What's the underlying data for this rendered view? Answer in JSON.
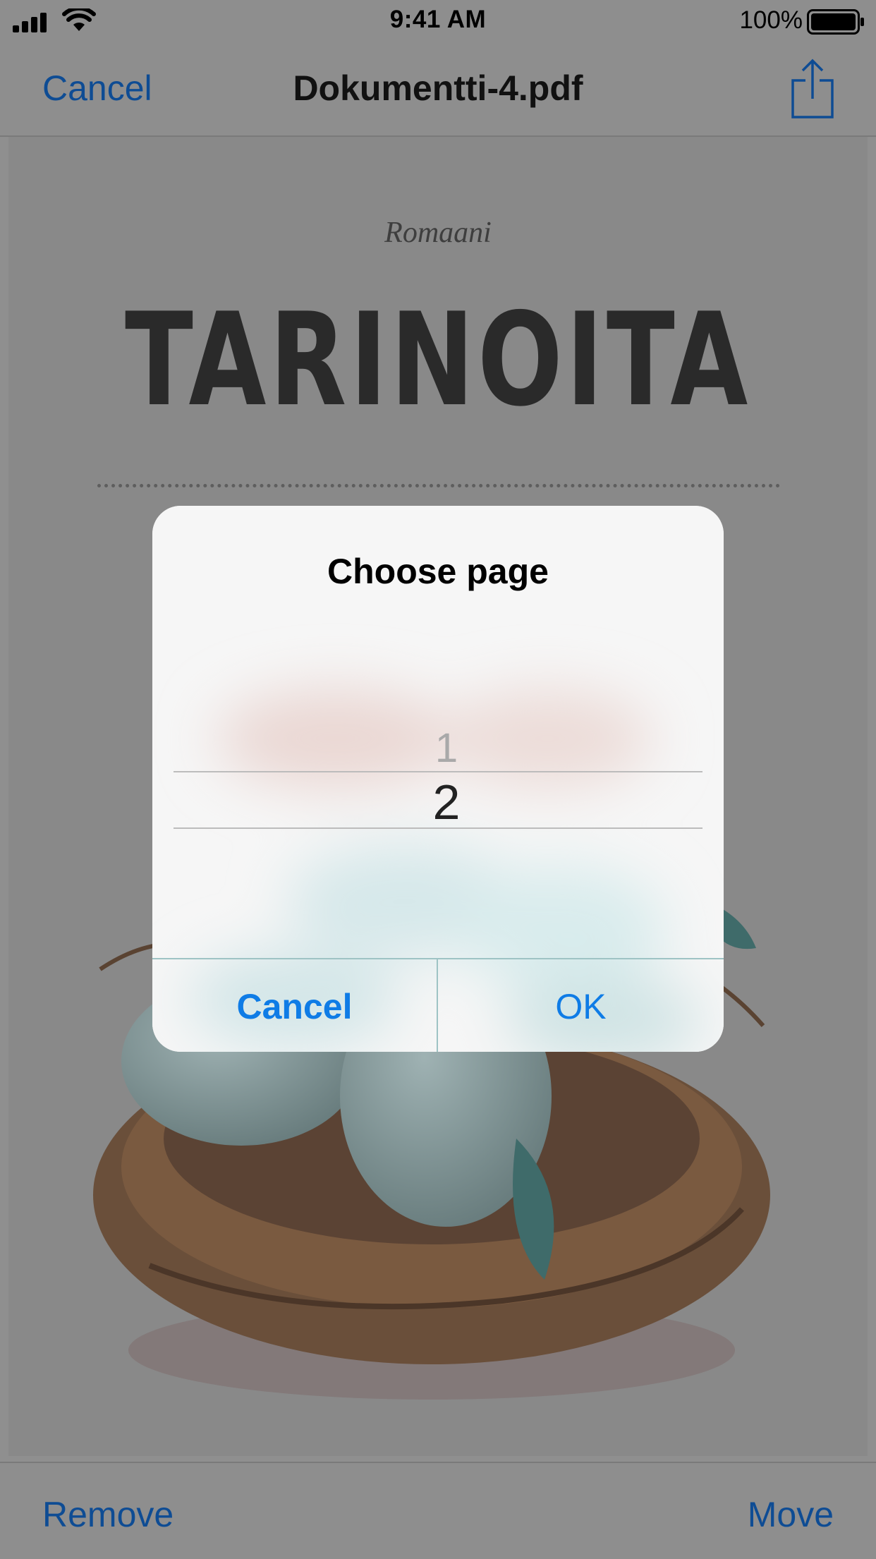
{
  "status_bar": {
    "time": "9:41 AM",
    "battery_percent": "100%",
    "battery_level": 1.0
  },
  "nav": {
    "cancel_label": "Cancel",
    "title": "Dokumentti-4.pdf",
    "share_icon": "share-icon"
  },
  "document": {
    "subtitle": "Romaani",
    "title": "TARINOITA"
  },
  "alert": {
    "title": "Choose page",
    "picker": {
      "previous_value": "1",
      "selected_value": "2"
    },
    "cancel_label": "Cancel",
    "ok_label": "OK",
    "accent_color": "#0f7ce6"
  },
  "bottom_bar": {
    "remove_label": "Remove",
    "move_label": "Move"
  },
  "colors": {
    "link": "#0e4c94",
    "dim_overlay": "#8e8e8e"
  }
}
